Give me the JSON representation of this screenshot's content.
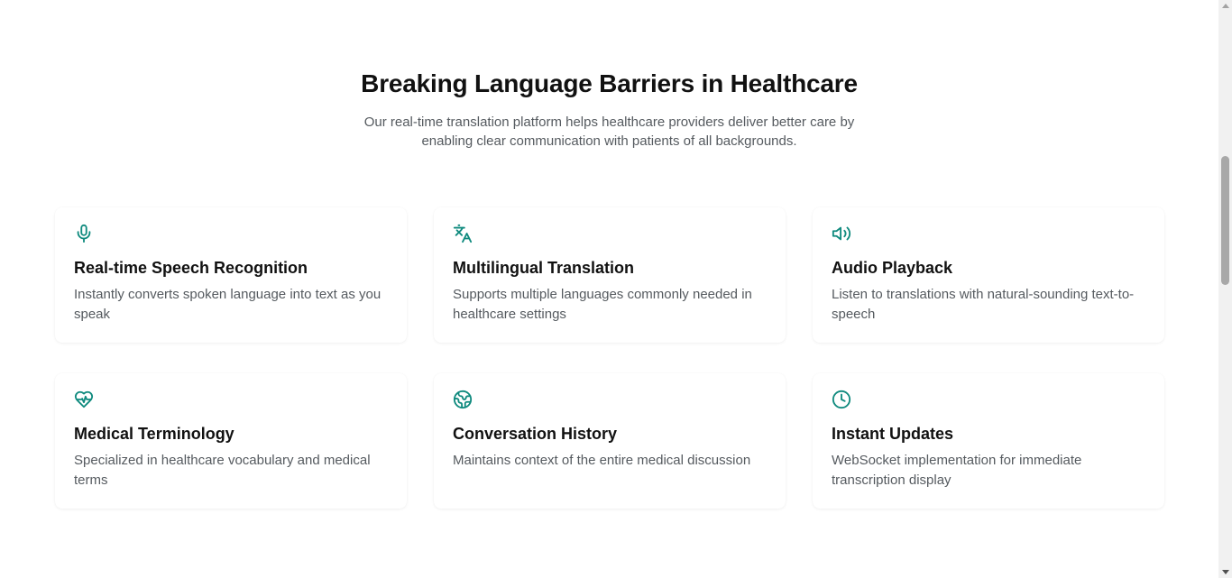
{
  "section": {
    "title": "Breaking Language Barriers in Healthcare",
    "subtitle": "Our real-time translation platform helps healthcare providers deliver better care by enabling clear communication with patients of all backgrounds."
  },
  "features": [
    {
      "icon": "microphone-icon",
      "title": "Real-time Speech Recognition",
      "description": "Instantly converts spoken language into text as you speak"
    },
    {
      "icon": "languages-icon",
      "title": "Multilingual Translation",
      "description": "Supports multiple languages commonly needed in healthcare settings"
    },
    {
      "icon": "speaker-icon",
      "title": "Audio Playback",
      "description": "Listen to translations with natural-sounding text-to-speech"
    },
    {
      "icon": "heart-pulse-icon",
      "title": "Medical Terminology",
      "description": "Specialized in healthcare vocabulary and medical terms"
    },
    {
      "icon": "globe-icon",
      "title": "Conversation History",
      "description": "Maintains context of the entire medical discussion"
    },
    {
      "icon": "clock-icon",
      "title": "Instant Updates",
      "description": "WebSocket implementation for immediate transcription display"
    }
  ],
  "colors": {
    "accent": "#0f8a7e",
    "heading": "#111111",
    "body_text": "#555a5f",
    "background": "#ffffff"
  }
}
